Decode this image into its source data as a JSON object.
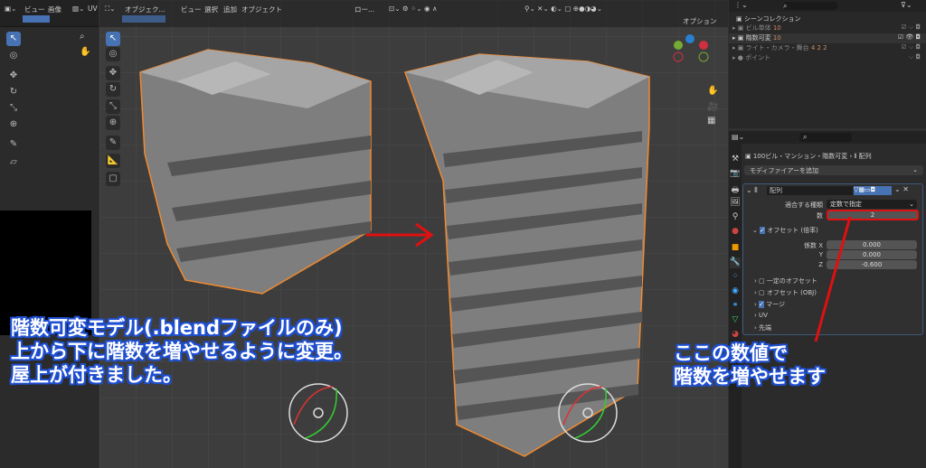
{
  "left_editor": {
    "menu": [
      "ビュー",
      "画像"
    ],
    "uv_label": "UV"
  },
  "viewport": {
    "mode": "オブジェク...",
    "menu": [
      "ビュー",
      "選択",
      "追加",
      "オブジェクト"
    ],
    "orientation": "ロー...",
    "options": "オプション"
  },
  "outliner": {
    "scene": "シーンコレクション",
    "items": [
      {
        "label": "ビル単体",
        "count": "10"
      },
      {
        "label": "階数可変",
        "count": "10"
      },
      {
        "label": "ライト・カメラ・舞台",
        "count": "4 2 2"
      },
      {
        "label": "ポイント",
        "count": ""
      }
    ]
  },
  "properties": {
    "breadcrumb_object": "100ビル・マンション・階数可変",
    "breadcrumb_modifier": "配列",
    "add_modifier": "モディファイアーを追加",
    "modifier_name": "配列",
    "fit_type_label": "適合する種類",
    "fit_type_value": "定数で指定",
    "count_label": "数",
    "count_value": "2",
    "relative_offset": "オフセット (倍率)",
    "factor_x_label": "係数 X",
    "factor_x": "0.000",
    "y_label": "Y",
    "factor_y": "0.000",
    "z_label": "Z",
    "factor_z": "-0.600",
    "sections": [
      "一定のオフセット",
      "オフセット (OBJ)",
      "マージ",
      "UV",
      "先端"
    ]
  },
  "annotations": {
    "left": [
      "階数可変モデル(.blendファイルのみ)",
      "上から下に階数を増やせるように変更。",
      "屋上が付きました。"
    ],
    "right": [
      "ここの数値で",
      "階数を増やせます"
    ]
  },
  "colors": {
    "accent": "#4772b3",
    "annotation_red": "#e01010",
    "selection": "#f08a30"
  }
}
